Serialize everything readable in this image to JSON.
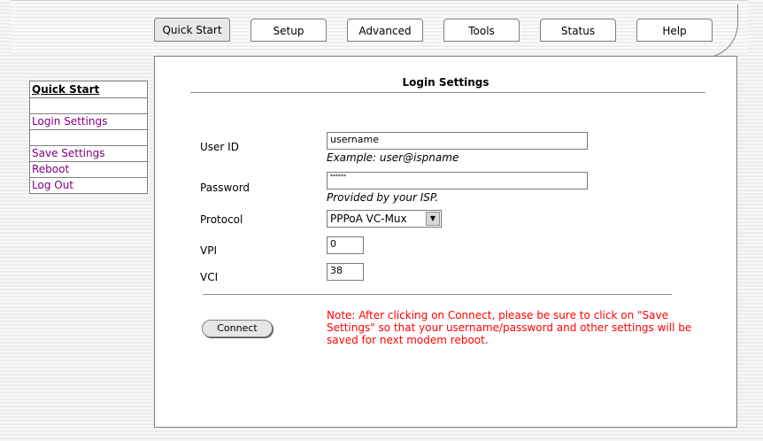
{
  "nav": {
    "tabs": [
      "Quick Start",
      "Setup",
      "Advanced",
      "Tools",
      "Status",
      "Help"
    ],
    "active_tab": "Quick Start"
  },
  "sidebar": {
    "title": "Quick Start",
    "items": [
      "Login Settings",
      "Save Settings",
      "Reboot",
      "Log Out"
    ]
  },
  "form": {
    "title": "Login Settings",
    "user_id": {
      "label": "User ID",
      "value": "username",
      "hint": "Example: user@ispname"
    },
    "password": {
      "label": "Password",
      "value": "******",
      "hint": "Provided by your ISP."
    },
    "protocol": {
      "label": "Protocol",
      "value": "PPPoA VC-Mux"
    },
    "vpi": {
      "label": "VPI",
      "value": "0"
    },
    "vci": {
      "label": "VCI",
      "value": "38"
    },
    "connect_label": "Connect",
    "note": "Note: After clicking on Connect, please be sure to click on \"Save Settings\" so that your username/password and other settings will be saved for next modem reboot."
  },
  "colors": {
    "note_text": "#ff0000",
    "link": "#800080",
    "border": "#808080"
  }
}
